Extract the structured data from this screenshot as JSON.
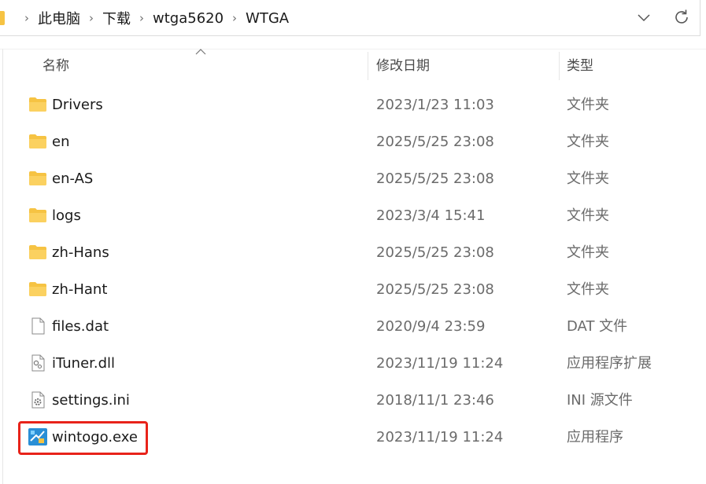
{
  "breadcrumb": {
    "items": [
      "此电脑",
      "下载",
      "wtga5620",
      "WTGA"
    ]
  },
  "columns": {
    "name": "名称",
    "date": "修改日期",
    "type": "类型"
  },
  "files": [
    {
      "name": "Drivers",
      "date": "2023/1/23 11:03",
      "type": "文件夹",
      "icon": "folder-icon"
    },
    {
      "name": "en",
      "date": "2025/5/25 23:08",
      "type": "文件夹",
      "icon": "folder-icon"
    },
    {
      "name": "en-AS",
      "date": "2025/5/25 23:08",
      "type": "文件夹",
      "icon": "folder-icon"
    },
    {
      "name": "logs",
      "date": "2023/3/4 15:41",
      "type": "文件夹",
      "icon": "folder-icon"
    },
    {
      "name": "zh-Hans",
      "date": "2025/5/25 23:08",
      "type": "文件夹",
      "icon": "folder-icon"
    },
    {
      "name": "zh-Hant",
      "date": "2025/5/25 23:08",
      "type": "文件夹",
      "icon": "folder-icon"
    },
    {
      "name": "files.dat",
      "date": "2020/9/4 23:59",
      "type": "DAT 文件",
      "icon": "file-icon"
    },
    {
      "name": "iTuner.dll",
      "date": "2023/11/19 11:24",
      "type": "应用程序扩展",
      "icon": "dll-icon"
    },
    {
      "name": "settings.ini",
      "date": "2018/11/1 23:46",
      "type": "INI 源文件",
      "icon": "ini-settings-icon"
    },
    {
      "name": "wintogo.exe",
      "date": "2023/11/19 11:24",
      "type": "应用程序",
      "icon": "wintogo-app-icon"
    }
  ],
  "colors": {
    "folder": "#f6c343",
    "highlight": "#e8231a"
  }
}
